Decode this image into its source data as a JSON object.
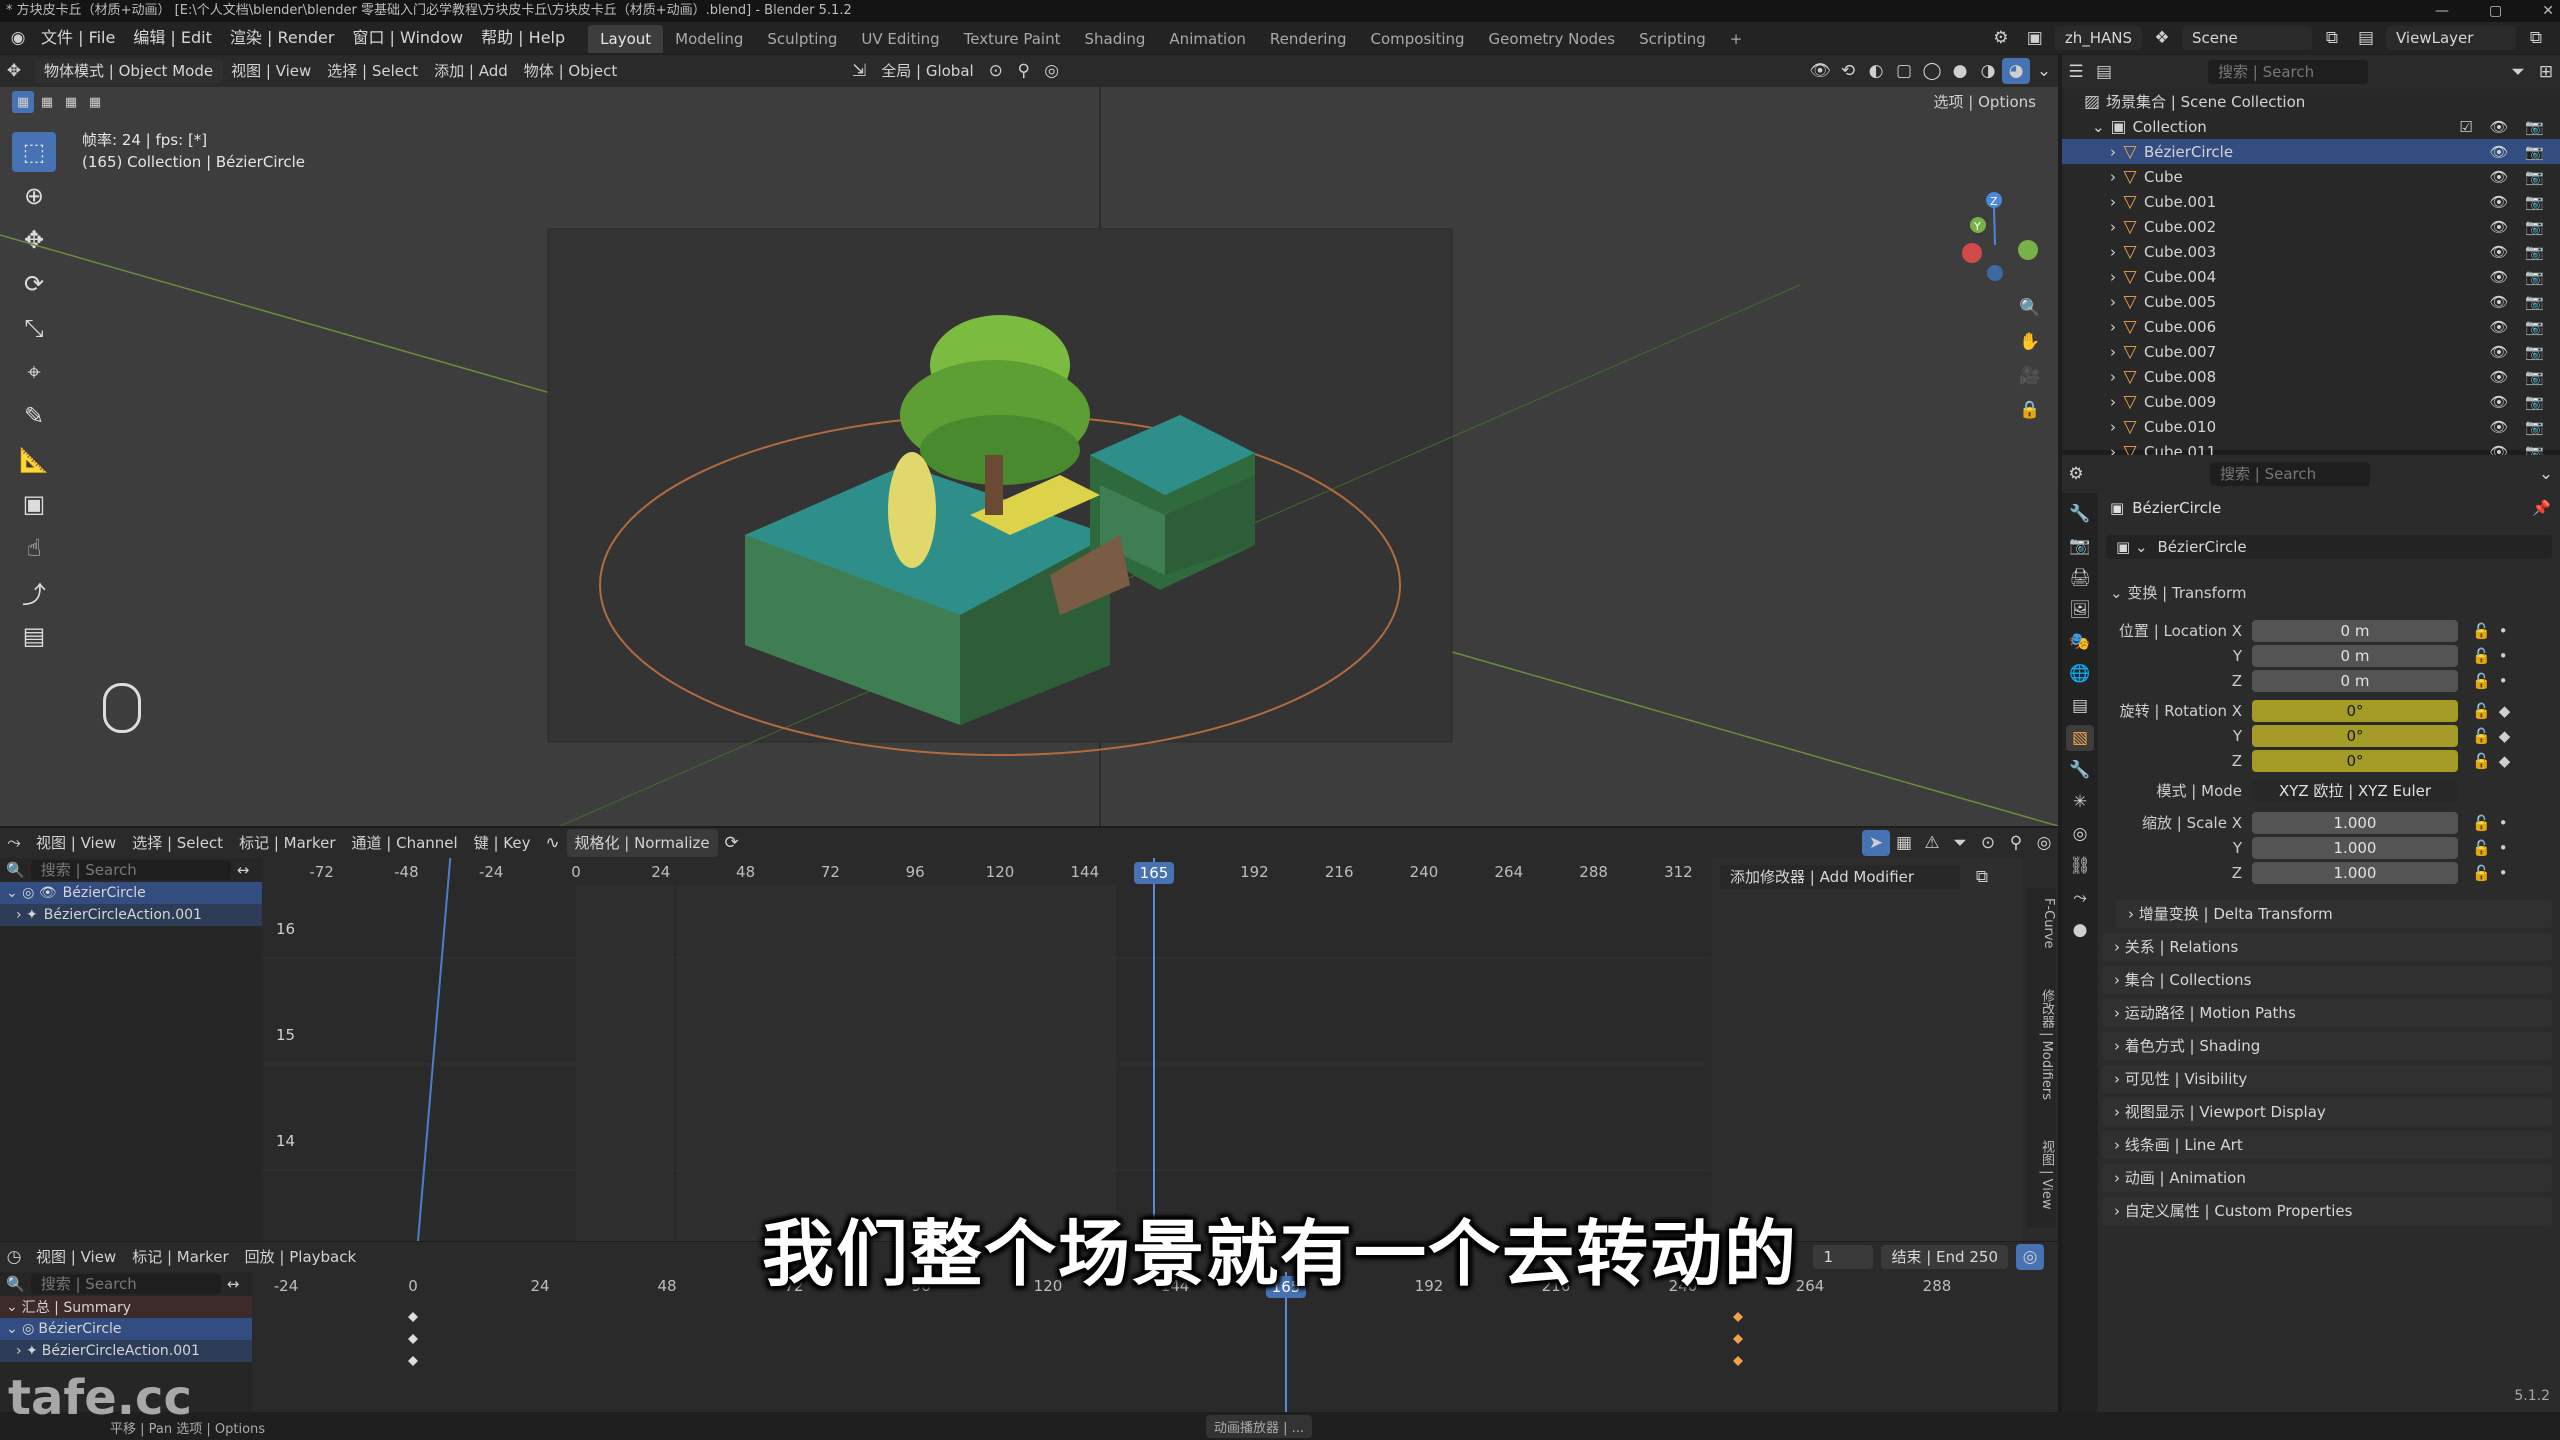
{
  "window": {
    "title": "* 方块皮卡丘（材质+动画） [E:\\个人文档\\blender\\blender 零基础入门必学教程\\方块皮卡丘\\方块皮卡丘（材质+动画）.blend] - Blender 5.1.2",
    "controls": [
      "—",
      "▢",
      "✕"
    ]
  },
  "menubar": {
    "items": [
      "文件 | File",
      "编辑 | Edit",
      "渲染 | Render",
      "窗口 | Window",
      "帮助 | Help"
    ],
    "workspaces": [
      "Layout",
      "Modeling",
      "Sculpting",
      "UV Editing",
      "Texture Paint",
      "Shading",
      "Animation",
      "Rendering",
      "Compositing",
      "Geometry Nodes",
      "Scripting"
    ],
    "active_workspace": "Layout",
    "add_tab": "+",
    "language": "zh_HANS",
    "scene": "Scene",
    "view_layer": "ViewLayer"
  },
  "viewport": {
    "header": {
      "mode": "物体模式 | Object Mode",
      "menus": [
        "视图 | View",
        "选择 | Select",
        "添加 | Add",
        "物体 | Object"
      ],
      "orientation_label": "全局 | Global",
      "options": "选项 | Options"
    },
    "overlay_info": {
      "line1": "帧率: 24 | fps: [*]",
      "line2": "(165) Collection | BézierCircle"
    },
    "tools": [
      "select-box",
      "cursor",
      "move",
      "rotate",
      "scale",
      "transform",
      "annotate",
      "measure",
      "add-cube",
      "shear",
      "extrude",
      "camera-tool"
    ]
  },
  "outliner": {
    "search_placeholder": "搜索 | Search",
    "scene_collection": "场景集合 | Scene Collection",
    "collection": "Collection",
    "items": [
      {
        "name": "BézierCircle",
        "selected": true
      },
      {
        "name": "Cube",
        "selected": false
      },
      {
        "name": "Cube.001",
        "selected": false
      },
      {
        "name": "Cube.002",
        "selected": false
      },
      {
        "name": "Cube.003",
        "selected": false
      },
      {
        "name": "Cube.004",
        "selected": false
      },
      {
        "name": "Cube.005",
        "selected": false
      },
      {
        "name": "Cube.006",
        "selected": false
      },
      {
        "name": "Cube.007",
        "selected": false
      },
      {
        "name": "Cube.008",
        "selected": false
      },
      {
        "name": "Cube.009",
        "selected": false
      },
      {
        "name": "Cube.010",
        "selected": false
      },
      {
        "name": "Cube.011",
        "selected": false
      }
    ]
  },
  "properties": {
    "search_placeholder": "搜索 | Search",
    "object_name": "BézierCircle",
    "data_name": "BézierCircle",
    "transform_header": "变换 | Transform",
    "location_label": "位置 | Location X",
    "location": [
      "0 m",
      "0 m",
      "0 m"
    ],
    "rotation_label": "旋转 | Rotation X",
    "rotation": [
      "0°",
      "0°",
      "0°"
    ],
    "mode_label": "模式 | Mode",
    "mode_value": "XYZ 欧拉 | XYZ Euler",
    "scale_label": "缩放 | Scale X",
    "scale": [
      "1.000",
      "1.000",
      "1.000"
    ],
    "axis_y": "Y",
    "axis_z": "Z",
    "panels": [
      "增量变换 | Delta Transform",
      "关系 | Relations",
      "集合 | Collections",
      "运动路径 | Motion Paths",
      "着色方式 | Shading",
      "可见性 | Visibility",
      "视图显示 | Viewport Display",
      "线条画 | Line Art",
      "动画 | Animation",
      "自定义属性 | Custom Properties"
    ]
  },
  "graph_editor": {
    "menus": [
      "视图 | View",
      "选择 | Select",
      "标记 | Marker",
      "通道 | Channel",
      "键 | Key"
    ],
    "normalize": "规格化 | Normalize",
    "search_placeholder": "搜索 | Search",
    "channels": [
      "BézierCircle",
      "BézierCircleAction.001"
    ],
    "frame_ticks": [
      "-72",
      "-48",
      "-24",
      "0",
      "24",
      "48",
      "72",
      "96",
      "120",
      "144",
      "165",
      "192",
      "216",
      "240",
      "264",
      "288",
      "312"
    ],
    "value_ticks": [
      "16",
      "15",
      "14"
    ],
    "current_frame": "165",
    "add_modifier": "添加修改器 | Add Modifier",
    "side_tabs": [
      "F-Curve",
      "修改器 | Modifiers",
      "视图 | View"
    ]
  },
  "timeline": {
    "menus": [
      "视图 | View",
      "标记 | Marker",
      "回放 | Playback"
    ],
    "search_placeholder": "搜索 | Search",
    "channels": [
      "汇总 | Summary",
      "BézierCircle",
      "BézierCircleAction.001"
    ],
    "frame_ticks": [
      "-24",
      "0",
      "24",
      "48",
      "72",
      "96",
      "120",
      "144",
      "165",
      "192",
      "216",
      "240",
      "264",
      "288"
    ],
    "current_frame": "165",
    "start": "1",
    "end_label": "结束 | End",
    "end": "250"
  },
  "statusbar": {
    "left": "平移 | Pan   选项 | Options",
    "center": "动画播放器 | ...",
    "version": "5.1.2"
  },
  "subtitle": "我们整个场景就有一个去转动的",
  "watermark": "tafe.cc",
  "colors": {
    "accent": "#4772b3",
    "keyframe": "#a39b25",
    "selection": "#334d80"
  }
}
